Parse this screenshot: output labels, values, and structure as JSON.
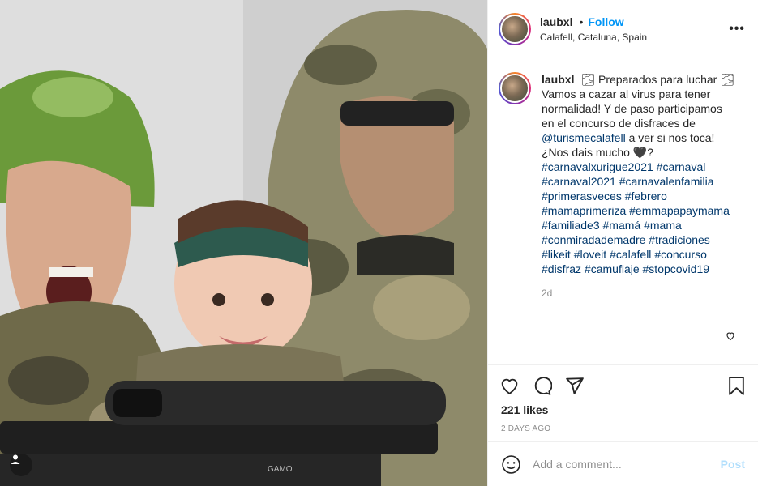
{
  "post": {
    "username": "laubxl",
    "follow_label": "Follow",
    "dot": "•",
    "location": "Calafell, Cataluna, Spain",
    "more_label": "•••"
  },
  "caption": {
    "username": "laubxl",
    "segments": [
      {
        "type": "text",
        "value": "🌫 Preparados para luchar 🌫 Vamos a cazar al virus para tener normalidad! Y de paso participamos en el concurso de disfraces de "
      },
      {
        "type": "mention",
        "value": "@turismecalafell"
      },
      {
        "type": "text",
        "value": " a ver si nos toca! ¿Nos dais mucho 🖤? "
      },
      {
        "type": "tag",
        "value": "#carnavalxurigue2021"
      },
      {
        "type": "text",
        "value": " "
      },
      {
        "type": "tag",
        "value": "#carnaval"
      },
      {
        "type": "text",
        "value": " "
      },
      {
        "type": "tag",
        "value": "#carnaval2021"
      },
      {
        "type": "text",
        "value": " "
      },
      {
        "type": "tag",
        "value": "#carnavalenfamilia"
      },
      {
        "type": "text",
        "value": " "
      },
      {
        "type": "tag",
        "value": "#primerasveces"
      },
      {
        "type": "text",
        "value": " "
      },
      {
        "type": "tag",
        "value": "#febrero"
      },
      {
        "type": "text",
        "value": " "
      },
      {
        "type": "tag",
        "value": "#mamaprimeriza"
      },
      {
        "type": "text",
        "value": " "
      },
      {
        "type": "tag",
        "value": "#emmapapaymama"
      },
      {
        "type": "text",
        "value": " "
      },
      {
        "type": "tag",
        "value": "#familiade3"
      },
      {
        "type": "text",
        "value": " "
      },
      {
        "type": "tag",
        "value": "#mamá"
      },
      {
        "type": "text",
        "value": " "
      },
      {
        "type": "tag",
        "value": "#mama"
      },
      {
        "type": "text",
        "value": " "
      },
      {
        "type": "tag",
        "value": "#conmiradademadre"
      },
      {
        "type": "text",
        "value": " "
      },
      {
        "type": "tag",
        "value": "#tradiciones"
      },
      {
        "type": "text",
        "value": " "
      },
      {
        "type": "tag",
        "value": "#likeit"
      },
      {
        "type": "text",
        "value": " "
      },
      {
        "type": "tag",
        "value": "#loveit"
      },
      {
        "type": "text",
        "value": " "
      },
      {
        "type": "tag",
        "value": "#calafell"
      },
      {
        "type": "text",
        "value": " "
      },
      {
        "type": "tag",
        "value": "#concurso"
      },
      {
        "type": "text",
        "value": " "
      },
      {
        "type": "tag",
        "value": "#disfraz"
      },
      {
        "type": "text",
        "value": " "
      },
      {
        "type": "tag",
        "value": "#camuflaje"
      },
      {
        "type": "text",
        "value": " "
      },
      {
        "type": "tag",
        "value": "#stopcovid19"
      }
    ],
    "time": "2d"
  },
  "actions": {
    "like_icon": "heart-icon",
    "comment_icon": "comment-icon",
    "share_icon": "share-icon",
    "save_icon": "bookmark-icon"
  },
  "likes": "221 likes",
  "timeago": "2 DAYS AGO",
  "comment_box": {
    "placeholder": "Add a comment...",
    "post_label": "Post",
    "emoji_icon": "smiley-icon"
  },
  "colors": {
    "follow": "#0095f6",
    "link": "#00376b",
    "muted": "#8e8e8e",
    "post_disabled": "#b2dffc"
  }
}
